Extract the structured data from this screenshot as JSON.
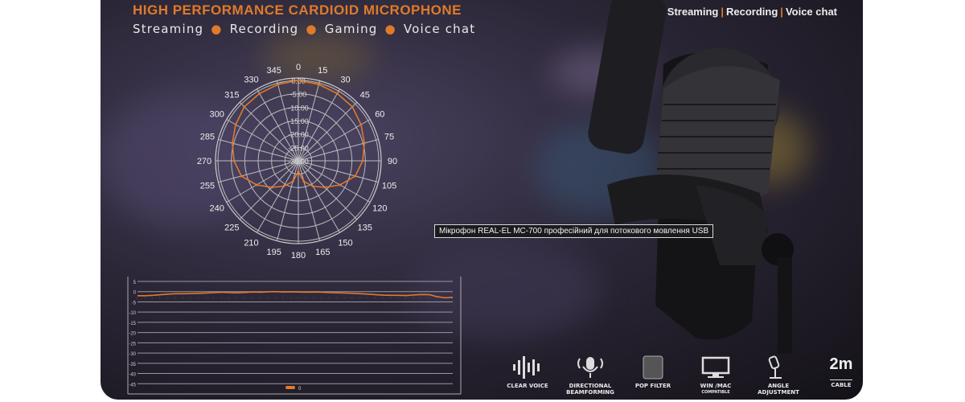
{
  "banner": {
    "title": "HIGH PERFORMANCE CARDIOID MICROPHONE",
    "subtitle": [
      "Streaming",
      "Recording",
      "Gaming",
      "Voice chat"
    ],
    "top_right": [
      "Streaming",
      "Recording",
      "Voice chat"
    ],
    "accent_color": "#e07a2a"
  },
  "tooltip": {
    "text": "Мікрофон REAL-EL MC-700 професійний для потокового мовлення USB"
  },
  "features": [
    {
      "label": "CLEAR VOICE",
      "icon": "waveform-icon"
    },
    {
      "label": "DIRECTIONAL BEAMFORMING",
      "icon": "microphone-icon"
    },
    {
      "label": "POP FILTER",
      "icon": "pop-filter-icon"
    },
    {
      "label": "WIN /MAC",
      "sub": "COMPATIBLE",
      "icon": "monitor-icon"
    },
    {
      "label": "ANGLE ADJUSTMENT",
      "icon": "mic-stand-icon"
    },
    {
      "label": "CABLE",
      "big": "2m",
      "icon": "cable-icon"
    }
  ],
  "chart_data": [
    {
      "type": "polar-line",
      "angle_labels": [
        "0",
        "15",
        "30",
        "45",
        "60",
        "75",
        "90",
        "105",
        "120",
        "135",
        "150",
        "165",
        "180",
        "195",
        "210",
        "225",
        "240",
        "255",
        "270",
        "285",
        "300",
        "315",
        "330",
        "345"
      ],
      "radial_labels": [
        "0.00",
        "-5.00",
        "-10.00",
        "-15.00",
        "-20.00",
        "-25.00",
        "-30.00"
      ],
      "rlim": [
        -30,
        0
      ],
      "angles": [
        0,
        15,
        30,
        45,
        60,
        75,
        90,
        105,
        120,
        135,
        150,
        165,
        180,
        195,
        210,
        225,
        240,
        255,
        270,
        285,
        300,
        315,
        330,
        345
      ],
      "values": [
        0,
        -0.5,
        -1,
        -1.5,
        -3,
        -4.5,
        -6,
        -8,
        -12,
        -16,
        -19,
        -22,
        -26,
        -22,
        -19,
        -16,
        -12,
        -8,
        -6,
        -4.5,
        -3,
        -1.5,
        -1,
        -0.5
      ],
      "color": "#e07a2a"
    },
    {
      "type": "line",
      "ylim": [
        -50,
        5
      ],
      "yticks": [
        5,
        0,
        -5,
        -10,
        -15,
        -20,
        -25,
        -30,
        -35,
        -40,
        -45
      ],
      "legend": "0",
      "legend_placement": "bottom",
      "values": [
        -2,
        -2,
        -1.8,
        -1.5,
        -1.2,
        -1,
        -1,
        -0.9,
        -0.8,
        -0.7,
        -0.5,
        -0.3,
        -0.5,
        -0.6,
        -0.4,
        -0.2,
        -0.3,
        -0.1,
        0,
        -0.2,
        -0.1,
        -0.2,
        -0.3,
        -0.2,
        -0.3,
        -0.5,
        -0.6,
        -0.7,
        -0.8,
        -1,
        -1.2,
        -1.5,
        -1.7,
        -1.8,
        -1.8,
        -1.9,
        -1.6,
        -1.4,
        -1.5,
        -2.5,
        -3,
        -2.8
      ],
      "grid": true,
      "color": "#e07a2a"
    }
  ]
}
